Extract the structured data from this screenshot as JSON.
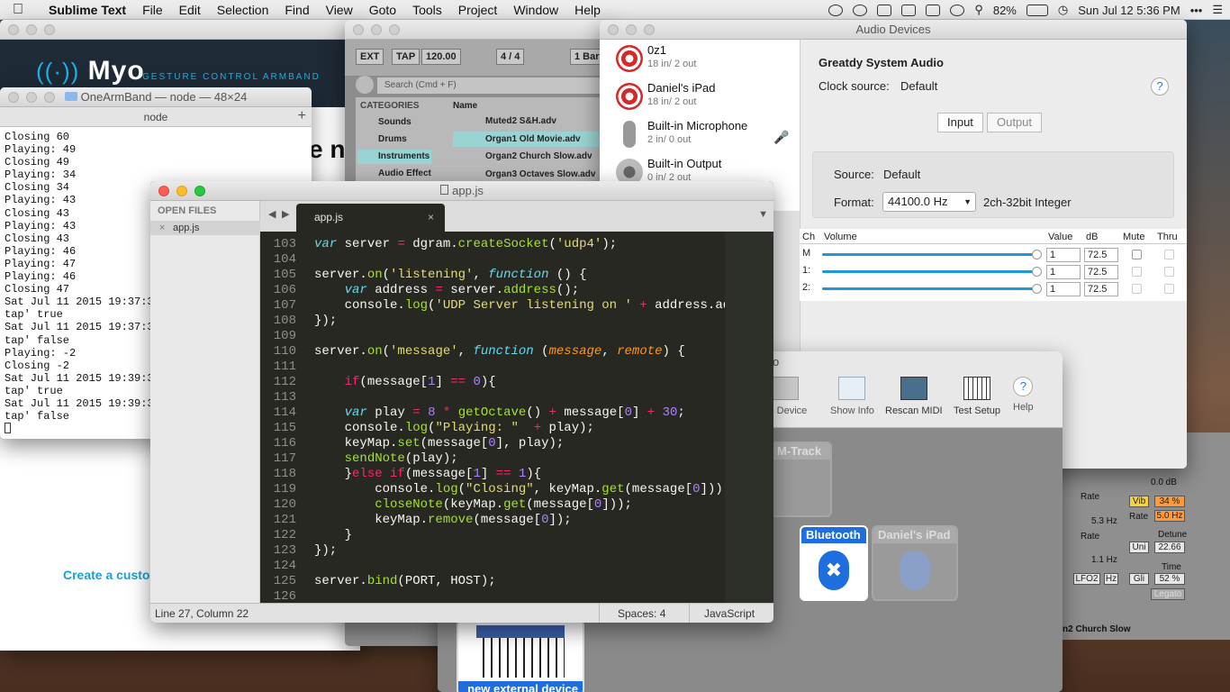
{
  "menubar": {
    "app": "Sublime Text",
    "items": [
      "File",
      "Edit",
      "Selection",
      "Find",
      "View",
      "Goto",
      "Tools",
      "Project",
      "Window",
      "Help"
    ],
    "battery": "82%",
    "clock": "Sun Jul 12  5:36 PM"
  },
  "myo": {
    "logo": "Myo",
    "tagline": "GESTURE CONTROL ARMBAND",
    "heading_partial": "e n",
    "cta": "Create a custo"
  },
  "terminal": {
    "title": "OneArmBand — node — 48×24",
    "tab": "node",
    "lines": [
      "Closing 60",
      "Playing: 49",
      "Closing 49",
      "Playing: 34",
      "Closing 34",
      "Playing: 43",
      "Closing 43",
      "Playing: 43",
      "Closing 43",
      "Playing: 46",
      "Playing: 47",
      "Playing: 46",
      "Closing 47",
      "Sat Jul 11 2015 19:37:3",
      "tap' true",
      "Sat Jul 11 2015 19:37:3",
      "tap' false",
      "Playing: -2",
      "Closing -2",
      "Sat Jul 11 2015 19:39:3",
      "tap' true",
      "Sat Jul 11 2015 19:39:3",
      "tap' false"
    ]
  },
  "ableton": {
    "ext": "EXT",
    "tap": "TAP",
    "tempo": "120.00",
    "sig": "4 / 4",
    "bar": "1 Bar",
    "search_placeholder": "Search (Cmd + F)",
    "categories_header": "CATEGORIES",
    "categories": [
      "Sounds",
      "Drums",
      "Instruments",
      "Audio Effect"
    ],
    "name_header": "Name",
    "files": [
      "Muted2 S&H.adv",
      "Organ1 Old Movie.adv",
      "Organ2 Church Slow.adv",
      "Organ3 Octaves Slow.adv"
    ],
    "track_label": "n2 Church Slow",
    "rate1": "Rate",
    "rate1_val": "5.3 Hz",
    "rate2": "Rate",
    "rate2_val": "1.1 Hz",
    "db_val": "0.0 dB",
    "vib": "Vib",
    "vib_val": "34 %",
    "rate3": "Rate",
    "rate3_val": "5.0 Hz",
    "detune": "Detune",
    "uni": "Uni",
    "detune_val": "22.66",
    "time": "Time",
    "gli": "Gli",
    "time_val": "52 %",
    "legato": "Legato",
    "lfo": "LFO2",
    "hz": "Hz"
  },
  "audio": {
    "title": "Audio Devices",
    "devices": [
      {
        "name": "0z1",
        "sub": "18 in/ 2 out"
      },
      {
        "name": "Daniel's iPad",
        "sub": "18 in/ 2 out"
      },
      {
        "name": "Built-in Microphone",
        "sub": "2 in/ 0 out"
      },
      {
        "name": "Built-in Output",
        "sub": "0 in/ 2 out"
      }
    ],
    "selected": "Greatdy System Audio",
    "clock_label": "Clock source:",
    "clock_value": "Default",
    "tab_input": "Input",
    "tab_output": "Output",
    "source_label": "Source:",
    "source_value": "Default",
    "format_label": "Format:",
    "format_value": "44100.0 Hz",
    "format_extra": "2ch-32bit Integer",
    "cols": [
      "Ch",
      "Volume",
      "Value",
      "dB",
      "Mute",
      "Thru"
    ],
    "channels": [
      {
        "ch": "M",
        "value": "1",
        "db": "72.5"
      },
      {
        "ch": "1:",
        "value": "1",
        "db": "72.5"
      },
      {
        "ch": "2:",
        "value": "1",
        "db": "72.5"
      }
    ]
  },
  "midi": {
    "title_partial": "o",
    "tools": [
      "ve Device",
      "Show Info",
      "Rescan MIDI",
      "Test Setup",
      "Help"
    ],
    "devices": [
      "M-Track",
      "Bluetooth",
      "Daniel's iPad",
      "new external device"
    ]
  },
  "sublime": {
    "title": "app.js",
    "open_files": "OPEN FILES",
    "file": "app.js",
    "tab": "app.js",
    "status_pos": "Line 27, Column 22",
    "status_spaces": "Spaces: 4",
    "status_lang": "JavaScript",
    "line_numbers": [
      "103",
      "104",
      "105",
      "106",
      "107",
      "108",
      "109",
      "110",
      "111",
      "112",
      "113",
      "114",
      "115",
      "116",
      "117",
      "118",
      "119",
      "120",
      "121",
      "122",
      "123",
      "124",
      "125",
      "126"
    ]
  }
}
